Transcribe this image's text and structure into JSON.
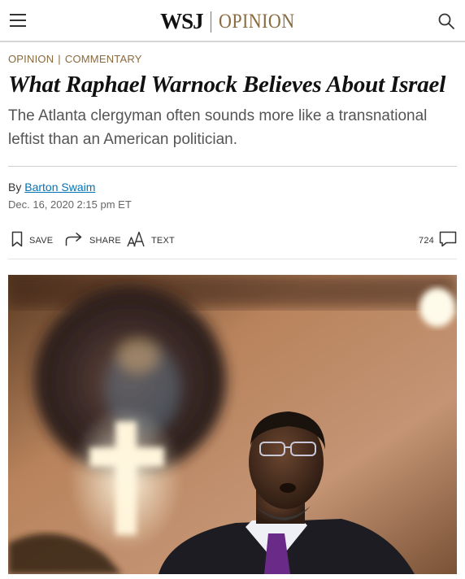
{
  "header": {
    "logo_wsj": "WSJ",
    "logo_section": "OPINION",
    "menu_icon": "hamburger-menu-icon",
    "search_icon": "search-icon"
  },
  "article": {
    "kicker_section": "OPINION",
    "kicker_category": "COMMENTARY",
    "headline": "What Raphael Warnock Believes About Israel",
    "dek": "The Atlanta clergyman often sounds more like a transnational leftist than an American politician.",
    "byline_prefix": "By",
    "author": "Barton Swaim",
    "timestamp": "Dec. 16, 2020 2:15 pm ET"
  },
  "toolbar": {
    "save_label": "SAVE",
    "share_label": "SHARE",
    "text_label": "TEXT",
    "comment_count": "724"
  },
  "colors": {
    "opinion_accent": "#8a6a3f",
    "link": "#0274b6",
    "headline": "#111111",
    "dek": "#555555"
  }
}
